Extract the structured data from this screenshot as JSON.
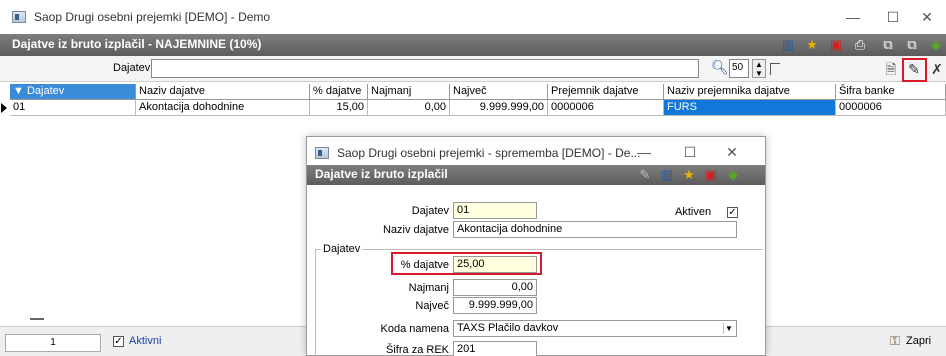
{
  "window": {
    "title": "Saop  Drugi osebni prejemki  [DEMO] - Demo",
    "minimize": "—",
    "maximize": "☐",
    "close": "✕"
  },
  "header": {
    "title": "Dajatve iz bruto izplačil - NAJEMNINE (10%)"
  },
  "filter": {
    "label": "Dajatev",
    "value": "",
    "limit": "50"
  },
  "grid": {
    "columns": [
      "Dajatev",
      "Naziv dajatve",
      "% dajatve",
      "Najmanj",
      "Največ",
      "Prejemnik dajatve",
      "Naziv prejemnika dajatve",
      "Šifra banke"
    ],
    "rows": [
      [
        "01",
        "Akontacija dohodnine",
        "15,00",
        "0,00",
        "9.999.999,00",
        "0000006",
        "FURS",
        "0000006"
      ]
    ]
  },
  "status": {
    "page": "1",
    "aktivni_label": "Aktivni",
    "aktivni_checked": "✓",
    "close_label": "Zapri"
  },
  "dialog": {
    "title": "Saop  Drugi osebni prejemki  - sprememba [DEMO] - De...",
    "header": "Dajatve iz bruto izplačil",
    "fields": {
      "dajatev_label": "Dajatev",
      "dajatev_value": "01",
      "aktiven_label": "Aktiven",
      "aktiven_checked": "✓",
      "naziv_label": "Naziv dajatve",
      "naziv_value": "Akontacija dohodnine",
      "section_label": "Dajatev",
      "pct_label": "% dajatve",
      "pct_value": "25,00",
      "najmanj_label": "Najmanj",
      "najmanj_value": "0,00",
      "najvec_label": "Največ",
      "najvec_value": "9.999.999,00",
      "koda_label": "Koda namena",
      "koda_value": "TAXS Plačilo davkov",
      "sifra_rek_label": "Šifra za REK",
      "sifra_rek_value": "201"
    }
  },
  "colors": {
    "highlight": "#d81a2a",
    "selected": "#1177d8",
    "header_bar": "#6b6b6b"
  }
}
